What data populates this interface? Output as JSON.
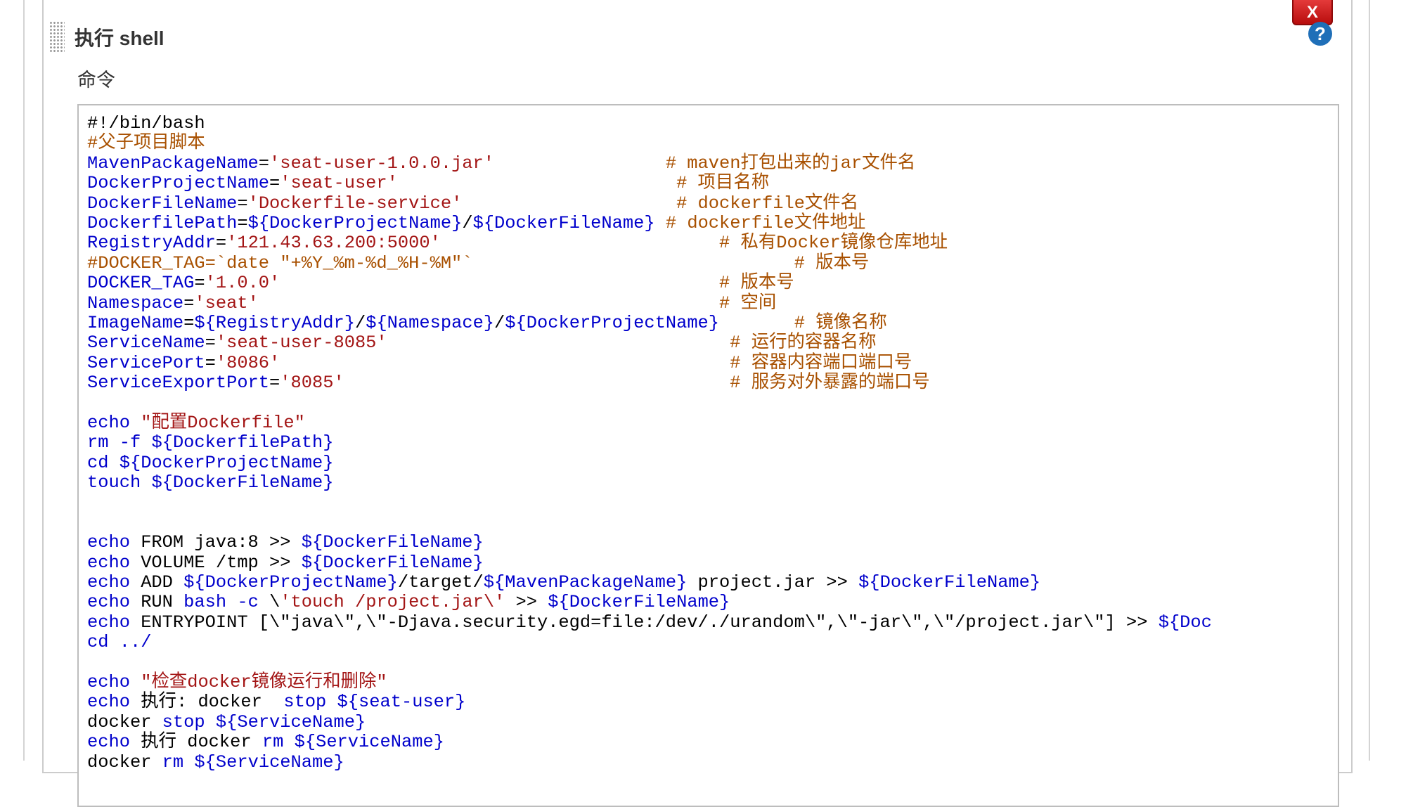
{
  "panel": {
    "title": "执行 shell",
    "delete_label": "X",
    "help_label": "?",
    "command_label": "命令"
  },
  "colors": {
    "comment": "#a85000",
    "variable": "#0000cc",
    "string": "#a31515",
    "keyword": "#0000cc",
    "plain": "#000000",
    "delete_button": "#d42020",
    "help_icon": "#1f6fb8"
  },
  "icons": {
    "drag_handle": "grip-dots-icon",
    "help": "question-circle-icon",
    "delete": "close-x-icon"
  },
  "code_lines": [
    [
      [
        "p",
        "#!/bin/bash"
      ]
    ],
    [
      [
        "c",
        "#父子项目脚本"
      ]
    ],
    [
      [
        "v",
        "MavenPackageName"
      ],
      [
        "p",
        "="
      ],
      [
        "s",
        "'seat-user-1.0.0.jar'"
      ],
      [
        "p",
        "                "
      ],
      [
        "c",
        "# maven打包出来的jar文件名"
      ]
    ],
    [
      [
        "v",
        "DockerProjectName"
      ],
      [
        "p",
        "="
      ],
      [
        "s",
        "'seat-user'"
      ],
      [
        "p",
        "                          "
      ],
      [
        "c",
        "# 项目名称"
      ]
    ],
    [
      [
        "v",
        "DockerFileName"
      ],
      [
        "p",
        "="
      ],
      [
        "s",
        "'Dockerfile-service'"
      ],
      [
        "p",
        "                    "
      ],
      [
        "c",
        "# dockerfile文件名"
      ]
    ],
    [
      [
        "v",
        "DockerfilePath"
      ],
      [
        "p",
        "="
      ],
      [
        "v",
        "${DockerProjectName}"
      ],
      [
        "p",
        "/"
      ],
      [
        "v",
        "${DockerFileName}"
      ],
      [
        "p",
        " "
      ],
      [
        "c",
        "# dockerfile文件地址"
      ]
    ],
    [
      [
        "v",
        "RegistryAddr"
      ],
      [
        "p",
        "="
      ],
      [
        "s",
        "'121.43.63.200:5000'"
      ],
      [
        "p",
        "                          "
      ],
      [
        "c",
        "# 私有Docker镜像仓库地址"
      ]
    ],
    [
      [
        "c",
        "#DOCKER_TAG=`date \"+%Y_%m-%d_%H-%M\"`                              # 版本号"
      ]
    ],
    [
      [
        "v",
        "DOCKER_TAG"
      ],
      [
        "p",
        "="
      ],
      [
        "s",
        "'1.0.0'"
      ],
      [
        "p",
        "                                         "
      ],
      [
        "c",
        "# 版本号"
      ]
    ],
    [
      [
        "v",
        "Namespace"
      ],
      [
        "p",
        "="
      ],
      [
        "s",
        "'seat'"
      ],
      [
        "p",
        "                                           "
      ],
      [
        "c",
        "# 空间"
      ]
    ],
    [
      [
        "v",
        "ImageName"
      ],
      [
        "p",
        "="
      ],
      [
        "v",
        "${RegistryAddr}"
      ],
      [
        "p",
        "/"
      ],
      [
        "v",
        "${Namespace}"
      ],
      [
        "p",
        "/"
      ],
      [
        "v",
        "${DockerProjectName}"
      ],
      [
        "p",
        "       "
      ],
      [
        "c",
        "# 镜像名称"
      ]
    ],
    [
      [
        "v",
        "ServiceName"
      ],
      [
        "p",
        "="
      ],
      [
        "s",
        "'seat-user-8085'"
      ],
      [
        "p",
        "                                "
      ],
      [
        "c",
        "# 运行的容器名称"
      ]
    ],
    [
      [
        "v",
        "ServicePort"
      ],
      [
        "p",
        "="
      ],
      [
        "s",
        "'8086'"
      ],
      [
        "p",
        "                                          "
      ],
      [
        "c",
        "# 容器内容端口端口号"
      ]
    ],
    [
      [
        "v",
        "ServiceExportPort"
      ],
      [
        "p",
        "="
      ],
      [
        "s",
        "'8085'"
      ],
      [
        "p",
        "                                    "
      ],
      [
        "c",
        "# 服务对外暴露的端口号"
      ]
    ],
    [
      [
        "p",
        ""
      ]
    ],
    [
      [
        "k",
        "echo"
      ],
      [
        "p",
        " "
      ],
      [
        "s",
        "\"配置Dockerfile\""
      ]
    ],
    [
      [
        "k",
        "rm"
      ],
      [
        "p",
        " "
      ],
      [
        "k",
        "-f"
      ],
      [
        "p",
        " "
      ],
      [
        "v",
        "${DockerfilePath}"
      ]
    ],
    [
      [
        "k",
        "cd"
      ],
      [
        "p",
        " "
      ],
      [
        "v",
        "${DockerProjectName}"
      ]
    ],
    [
      [
        "k",
        "touch"
      ],
      [
        "p",
        " "
      ],
      [
        "v",
        "${DockerFileName}"
      ]
    ],
    [
      [
        "p",
        ""
      ]
    ],
    [
      [
        "p",
        ""
      ]
    ],
    [
      [
        "k",
        "echo"
      ],
      [
        "p",
        " FROM java:8 >> "
      ],
      [
        "v",
        "${DockerFileName}"
      ]
    ],
    [
      [
        "k",
        "echo"
      ],
      [
        "p",
        " VOLUME /tmp >> "
      ],
      [
        "v",
        "${DockerFileName}"
      ]
    ],
    [
      [
        "k",
        "echo"
      ],
      [
        "p",
        " ADD "
      ],
      [
        "v",
        "${DockerProjectName}"
      ],
      [
        "p",
        "/target/"
      ],
      [
        "v",
        "${MavenPackageName}"
      ],
      [
        "p",
        " project.jar >> "
      ],
      [
        "v",
        "${DockerFileName}"
      ]
    ],
    [
      [
        "k",
        "echo"
      ],
      [
        "p",
        " RUN "
      ],
      [
        "k",
        "bash"
      ],
      [
        "p",
        " "
      ],
      [
        "k",
        "-c"
      ],
      [
        "p",
        " \\"
      ],
      [
        "s",
        "'touch /project.jar\\'"
      ],
      [
        "p",
        " >> "
      ],
      [
        "v",
        "${DockerFileName}"
      ]
    ],
    [
      [
        "k",
        "echo"
      ],
      [
        "p",
        " ENTRYPOINT [\\\"java\\\",\\\"-Djava.security.egd=file:/dev/./urandom\\\",\\\"-jar\\\",\\\"/project.jar\\\"] >> "
      ],
      [
        "v",
        "${Doc"
      ]
    ],
    [
      [
        "k",
        "cd"
      ],
      [
        "p",
        " "
      ],
      [
        "k",
        "../"
      ]
    ],
    [
      [
        "p",
        ""
      ]
    ],
    [
      [
        "k",
        "echo"
      ],
      [
        "p",
        " "
      ],
      [
        "s",
        "\"检查docker镜像运行和删除\""
      ]
    ],
    [
      [
        "k",
        "echo"
      ],
      [
        "p",
        " 执行: docker  "
      ],
      [
        "k",
        "stop"
      ],
      [
        "p",
        " "
      ],
      [
        "v",
        "${seat-user}"
      ]
    ],
    [
      [
        "p",
        "docker "
      ],
      [
        "k",
        "stop"
      ],
      [
        "p",
        " "
      ],
      [
        "v",
        "${ServiceName}"
      ]
    ],
    [
      [
        "k",
        "echo"
      ],
      [
        "p",
        " 执行 docker "
      ],
      [
        "k",
        "rm"
      ],
      [
        "p",
        " "
      ],
      [
        "v",
        "${ServiceName}"
      ]
    ],
    [
      [
        "p",
        "docker "
      ],
      [
        "k",
        "rm"
      ],
      [
        "p",
        " "
      ],
      [
        "v",
        "${ServiceName}"
      ]
    ]
  ]
}
